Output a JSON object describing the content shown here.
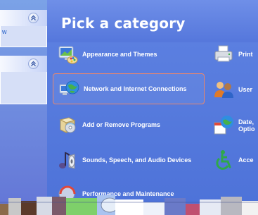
{
  "main": {
    "title": "Pick a category"
  },
  "left_pane": {
    "sections": [
      {
        "title_fragment": "",
        "item_fragment": "w"
      },
      {
        "title_fragment": "",
        "item_fragment": ""
      }
    ]
  },
  "categories": [
    {
      "label": "Appearance and Themes",
      "icon": "appearance-themes-icon"
    },
    {
      "label": "Network and Internet Connections",
      "icon": "network-internet-icon"
    },
    {
      "label": "Add or Remove Programs",
      "icon": "add-remove-programs-icon"
    },
    {
      "label": "Sounds, Speech, and Audio Devices",
      "icon": "sounds-audio-icon"
    },
    {
      "label": "Performance and Maintenance",
      "icon": "performance-maintenance-icon"
    },
    {
      "label": "Print",
      "icon": "printer-icon"
    },
    {
      "label": "User",
      "icon": "user-accounts-icon"
    },
    {
      "label": "Date,",
      "label2": "Optio",
      "icon": "date-time-icon"
    },
    {
      "label": "Acce",
      "icon": "accessibility-icon"
    }
  ],
  "colors": {
    "pane_blue": "#6375d6",
    "title_blue": "#5577dc",
    "highlight_border": "#e8866e"
  }
}
